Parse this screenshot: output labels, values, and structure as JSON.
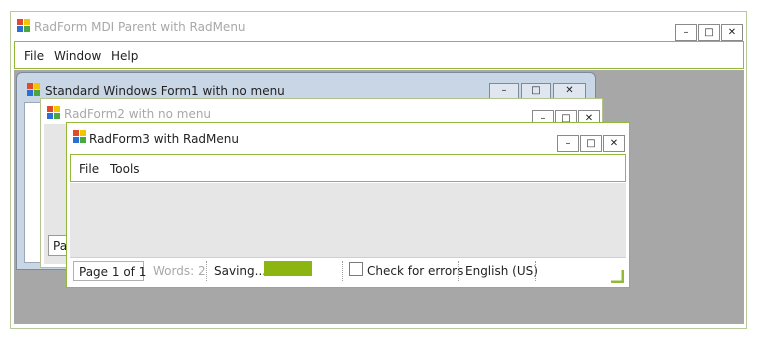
{
  "parent": {
    "title": "RadForm MDI Parent with RadMenu",
    "menu": [
      "File",
      "Window",
      "Help"
    ],
    "controls": {
      "minimize": "–",
      "maximize": "□",
      "close": "✕"
    }
  },
  "form1": {
    "title": "Standard Windows Form1 with no menu",
    "controls": {
      "minimize": "–",
      "maximize": "□",
      "close": "✕"
    },
    "partial_text": "Pa"
  },
  "form2": {
    "title": "RadForm2 with no menu",
    "controls": {
      "minimize": "–",
      "maximize": "□",
      "close": "✕"
    }
  },
  "form3": {
    "title": "RadForm3 with RadMenu",
    "menu": [
      "File",
      "Tools"
    ],
    "controls": {
      "minimize": "–",
      "maximize": "□",
      "close": "✕"
    },
    "status": {
      "page": "Page 1 of 1",
      "words": "Words: 2",
      "saving": "Saving...",
      "progress": 1.0,
      "check_label": "Check for errors",
      "check_checked": false,
      "language": "English (US)"
    }
  },
  "colors": {
    "accent": "#94b83a",
    "progress": "#8db512",
    "mdi_bg": "#a7a7a7",
    "client_bg": "#e6e6e6"
  }
}
